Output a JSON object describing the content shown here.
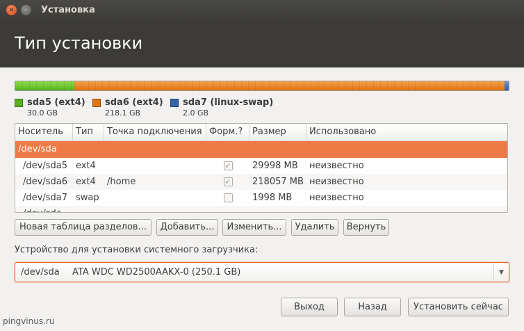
{
  "window": {
    "title": "Установка",
    "close_glyph": "×",
    "min_glyph": "–"
  },
  "header": {
    "title": "Тип установки"
  },
  "colors": {
    "accent": "#e95420",
    "ext4_primary": "#58b11e",
    "ext4_secondary": "#e0740f",
    "swap": "#3465a4",
    "selected_row": "#ed7a45"
  },
  "disk_usage": {
    "segments": [
      {
        "name": "sda5 (ext4)",
        "size": "30.0 GB",
        "fraction": 0.12
      },
      {
        "name": "sda6 (ext4)",
        "size": "218.1 GB",
        "fraction": 0.871
      },
      {
        "name": "sda7 (linux-swap)",
        "size": "2.0 GB",
        "fraction": 0.009
      }
    ]
  },
  "table": {
    "headers": [
      "Носитель",
      "Тип",
      "Точка подключения",
      "Форм.?",
      "Размер",
      "Использовано"
    ],
    "device_row": "/dev/sda",
    "rows": [
      {
        "device": "/dev/sda5",
        "type": "ext4",
        "mount": "",
        "format": true,
        "size": "29998 MB",
        "used": "неизвестно"
      },
      {
        "device": "/dev/sda6",
        "type": "ext4",
        "mount": "/home",
        "format": true,
        "size": "218057 MB",
        "used": "неизвестно"
      },
      {
        "device": "/dev/sda7",
        "type": "swap",
        "mount": "",
        "format": false,
        "size": "1998 MB",
        "used": "неизвестно"
      }
    ],
    "partial_row": "/dev/sdc",
    "check_glyph": "✓"
  },
  "table_buttons": {
    "new_table": "Новая таблица разделов...",
    "add": "Добавить...",
    "change": "Изменить...",
    "delete": "Удалить",
    "revert": "Вернуть"
  },
  "bootloader": {
    "label": "Устройство для установки системного загрузчика:",
    "device": "/dev/sda",
    "model": "ATA WDC WD2500AAKX-0 (250.1 GB)",
    "arrow_glyph": "▼"
  },
  "footer_buttons": {
    "quit": "Выход",
    "back": "Назад",
    "install": "Установить сейчас"
  },
  "watermark": "pingvinus.ru"
}
